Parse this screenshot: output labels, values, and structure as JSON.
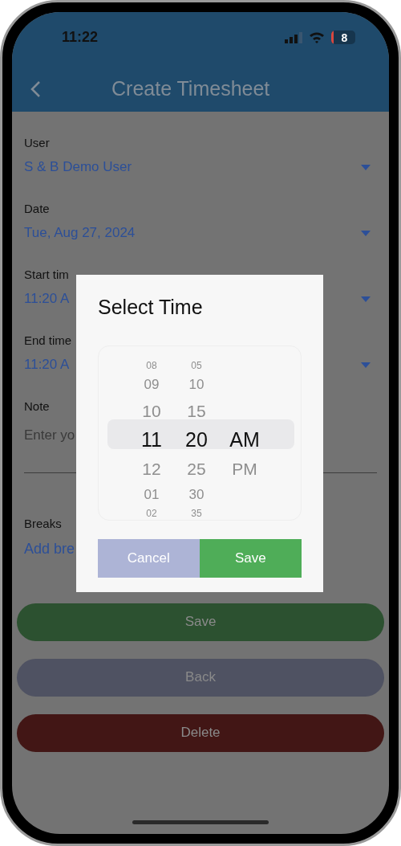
{
  "status_bar": {
    "time": "11:22",
    "battery": "8"
  },
  "header": {
    "title": "Create Timesheet"
  },
  "form": [
    {
      "kind": "dropdown",
      "label": "User",
      "value": "S & B Demo User"
    },
    {
      "kind": "dropdown",
      "label": "Date",
      "value": "Tue, Aug 27, 2024"
    },
    {
      "kind": "dropdown",
      "label": "Start tim",
      "value": "11:20 A"
    },
    {
      "kind": "dropdown",
      "label": "End time",
      "value": "11:20 A"
    },
    {
      "kind": "textarea",
      "label": "Note",
      "placeholder": "Enter yo"
    }
  ],
  "breaks": {
    "label": "Breaks",
    "link": "Add bre"
  },
  "buttons": [
    {
      "label": "Save",
      "color": "#2c5130"
    },
    {
      "label": "Back",
      "color": "#4f5262"
    },
    {
      "label": "Delete",
      "color": "#421615"
    }
  ],
  "dialog": {
    "title": "Select Time",
    "columns": [
      [
        {
          "label": "08",
          "selected": false
        },
        {
          "label": "09",
          "selected": false
        },
        {
          "label": "10",
          "selected": false
        },
        {
          "label": "11",
          "selected": true
        },
        {
          "label": "12",
          "selected": false
        },
        {
          "label": "01",
          "selected": false
        },
        {
          "label": "02",
          "selected": false
        }
      ],
      [
        {
          "label": "05",
          "selected": false
        },
        {
          "label": "10",
          "selected": false
        },
        {
          "label": "15",
          "selected": false
        },
        {
          "label": "20",
          "selected": true
        },
        {
          "label": "25",
          "selected": false
        },
        {
          "label": "30",
          "selected": false
        },
        {
          "label": "35",
          "selected": false
        }
      ],
      [
        {
          "label": "AM",
          "selected": true
        },
        {
          "label": "PM",
          "selected": false
        }
      ]
    ],
    "cancel": "Cancel",
    "save": "Save"
  }
}
